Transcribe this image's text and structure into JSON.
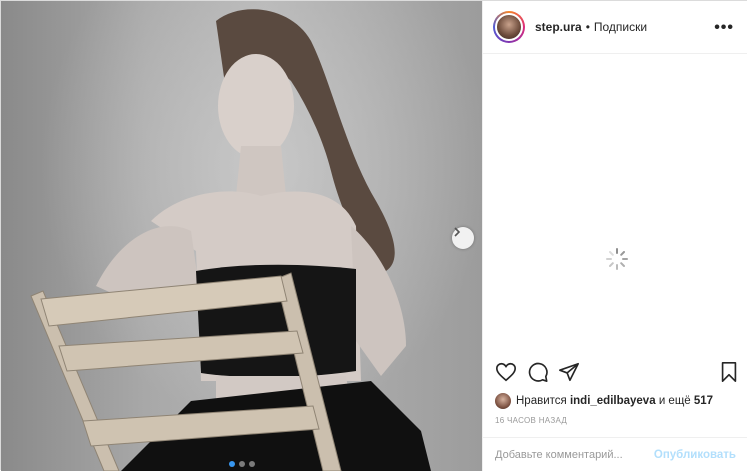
{
  "header": {
    "username": "step.ura",
    "separator": "•",
    "follow_label": "Подписки",
    "more_label": "•••"
  },
  "carousel": {
    "slide_count": 3,
    "active_slide": 1
  },
  "icons": {
    "like": "heart-icon",
    "comment": "comment-icon",
    "share": "share-icon",
    "save": "bookmark-icon",
    "next": "chevron-right-icon",
    "loading": "spinner-icon"
  },
  "likes": {
    "prefix": "Нравится",
    "liked_by": "indi_edilbayeva",
    "middle": "и ещё",
    "count": "517"
  },
  "timestamp": "16 ЧАСОВ НАЗАД",
  "comment_box": {
    "placeholder": "Добавьте комментарий...",
    "publish_label": "Опубликовать"
  },
  "colors": {
    "accent": "#3897f0",
    "publish_disabled": "#b2dffc",
    "text": "#262626",
    "muted": "#999999"
  }
}
